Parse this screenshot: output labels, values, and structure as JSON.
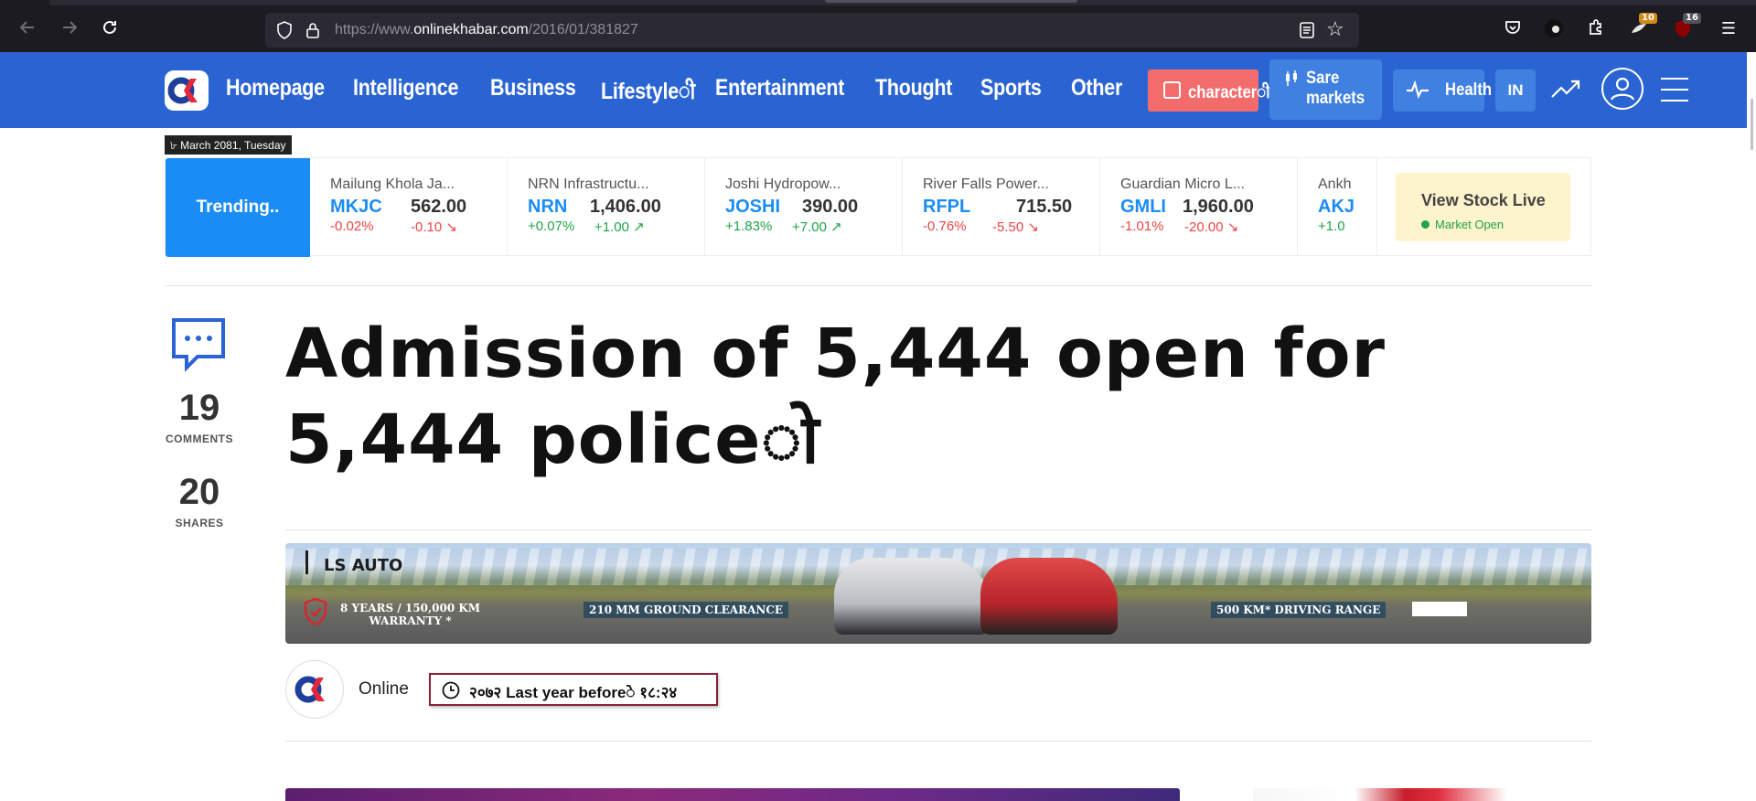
{
  "browser": {
    "url_prefix": "https://www.",
    "url_domain": "onlinekhabar.com",
    "url_path": "/2016/01/381827",
    "back_icon": "arrow-left-icon",
    "forward_icon": "arrow-right-icon",
    "reload_icon": "reload-icon",
    "extension_badge_1": "10",
    "extension_badge_2": "16"
  },
  "header": {
    "logo_text": "OK",
    "nav": [
      "Homepage",
      "Intelligence",
      "Business",
      "Lifestyleी",
      "Entertainment",
      "Thought",
      "Sports",
      "Other"
    ],
    "character_label": "characterी",
    "share_label_1": "Sare",
    "share_label_2": "markets",
    "health_label": "Health",
    "lang_label": "IN",
    "colors": {
      "header_bg": "#2a64d2",
      "accent_red": "#f36c6c",
      "button_blue": "#3f80e0"
    }
  },
  "date_tag": "৮ March 2081, Tuesday",
  "trending": {
    "label": "Trending..",
    "stocks": [
      {
        "name": "Mailung Khola Ja...",
        "symbol": "MKJC",
        "price": "562.00",
        "pct": "-0.02%",
        "change": "-0.10",
        "dir": "down"
      },
      {
        "name": "NRN Infrastructu...",
        "symbol": "NRN",
        "price": "1,406.00",
        "pct": "+0.07%",
        "change": "+1.00",
        "dir": "up"
      },
      {
        "name": "Joshi Hydropow...",
        "symbol": "JOSHI",
        "price": "390.00",
        "pct": "+1.83%",
        "change": "+7.00",
        "dir": "up"
      },
      {
        "name": "River Falls Power...",
        "symbol": "RFPL",
        "price": "715.50",
        "pct": "-0.76%",
        "change": "-5.50",
        "dir": "down"
      },
      {
        "name": "Guardian Micro L...",
        "symbol": "GMLI",
        "price": "1,960.00",
        "pct": "-1.01%",
        "change": "-20.00",
        "dir": "down"
      },
      {
        "name": "Ankh",
        "symbol": "AKJ",
        "price": "",
        "pct": "+1.0",
        "change": "",
        "dir": "up"
      }
    ],
    "view_stock_label": "View Stock Live",
    "market_status": "Market Open"
  },
  "article": {
    "comments_count": "19",
    "comments_label": "COMMENTS",
    "shares_count": "20",
    "shares_label": "SHARES",
    "title": "Admission of 5,444 open for 5,444 policeो",
    "author": "Online",
    "time": "२०७२ Last year beforeे १८:२४"
  },
  "ad": {
    "brand": "LS AUTO",
    "warranty_1": "8 YEARS / 150,000 KM",
    "warranty_2": "WARRANTY *",
    "clearance": "210 MM GROUND CLEARANCE",
    "range": "500 KM* DRIVING RANGE"
  }
}
